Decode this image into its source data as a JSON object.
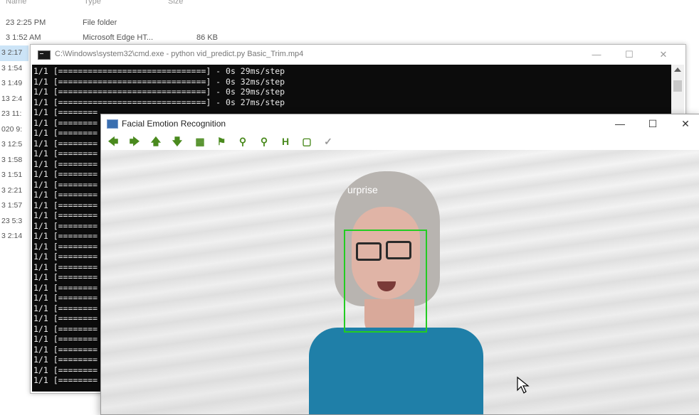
{
  "explorer": {
    "header_cols": [
      "Name",
      "Type",
      "Size"
    ],
    "rows": [
      {
        "date": "23 2:25 PM",
        "type": "File folder",
        "size": ""
      },
      {
        "date": "3 1:52 AM",
        "type": "Microsoft Edge HT...",
        "size": "86 KB"
      }
    ],
    "date_list": [
      "3 2:17",
      "3 1:54",
      "3 1:49",
      "13 2:4",
      "23 11:",
      "020 9:",
      "3 12:5",
      "3 1:58",
      "3 1:51",
      "3 2:21",
      "3 1:57",
      "23 5:3",
      "3 2:14"
    ]
  },
  "cmd": {
    "title": "C:\\Windows\\system32\\cmd.exe - python  vid_predict.py Basic_Trim.mp4",
    "minimize": "—",
    "maximize": "☐",
    "close": "✕",
    "lines_full": [
      "1/1 [==============================] - 0s 29ms/step",
      "1/1 [==============================] - 0s 32ms/step",
      "1/1 [==============================] - 0s 29ms/step",
      "1/1 [==============================] - 0s 27ms/step"
    ],
    "line_partial": "1/1 [========"
  },
  "emotion_window": {
    "title": "Facial Emotion Recognition",
    "minimize": "—",
    "maximize": "☐",
    "close": "✕",
    "toolbar": [
      "arrow-left-icon",
      "arrow-right-icon",
      "arrow-up-icon",
      "arrow-down-icon",
      "image-icon",
      "flag-icon",
      "zoom-in-icon",
      "zoom-out-icon",
      "save-icon",
      "copy-icon",
      "settings-icon"
    ],
    "detected_emotion": "urprise",
    "box_color": "#22cc22"
  }
}
